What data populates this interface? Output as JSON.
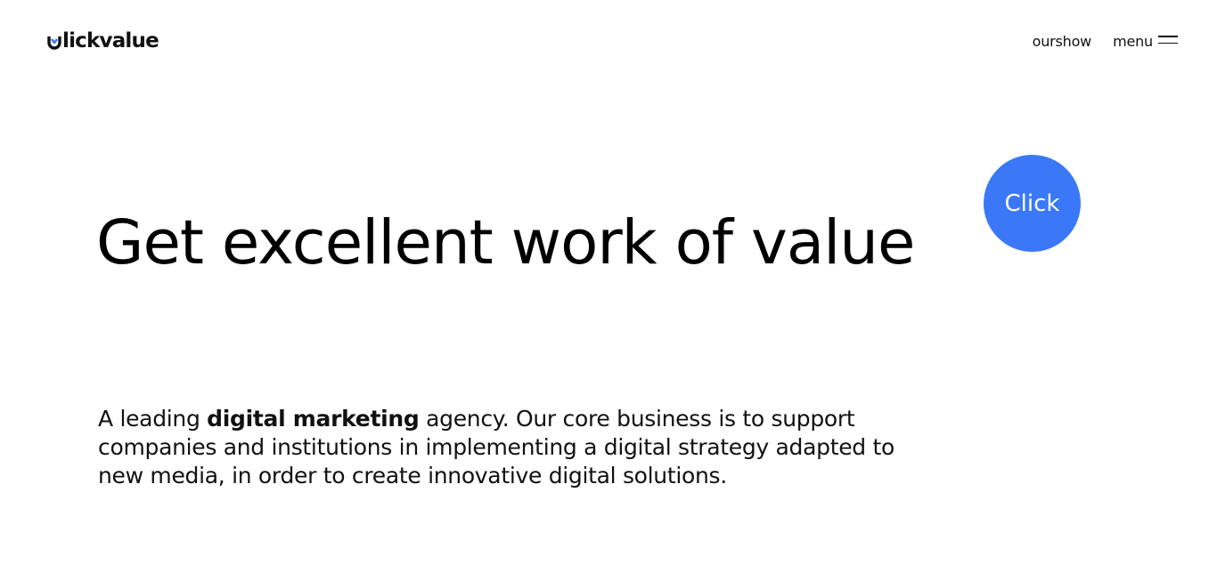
{
  "header": {
    "logo_text": "lickvalue",
    "logo_icon": "cv-logo-mark-icon",
    "nav": {
      "ourshow_label": "ourshow",
      "menu_label": "menu",
      "menu_icon": "hamburger-icon"
    }
  },
  "hero": {
    "title": "Get excellent work of value",
    "click_label": "Click",
    "description": {
      "part1": "A leading ",
      "highlight": "digital marketing",
      "part2": " agency. Our core business is to support companies and institutions in implementing a digital strategy adapted to new media, in order to create innovative digital solutions."
    }
  },
  "colors": {
    "accent": "#3b78f7",
    "text": "#000000",
    "background": "#ffffff"
  }
}
